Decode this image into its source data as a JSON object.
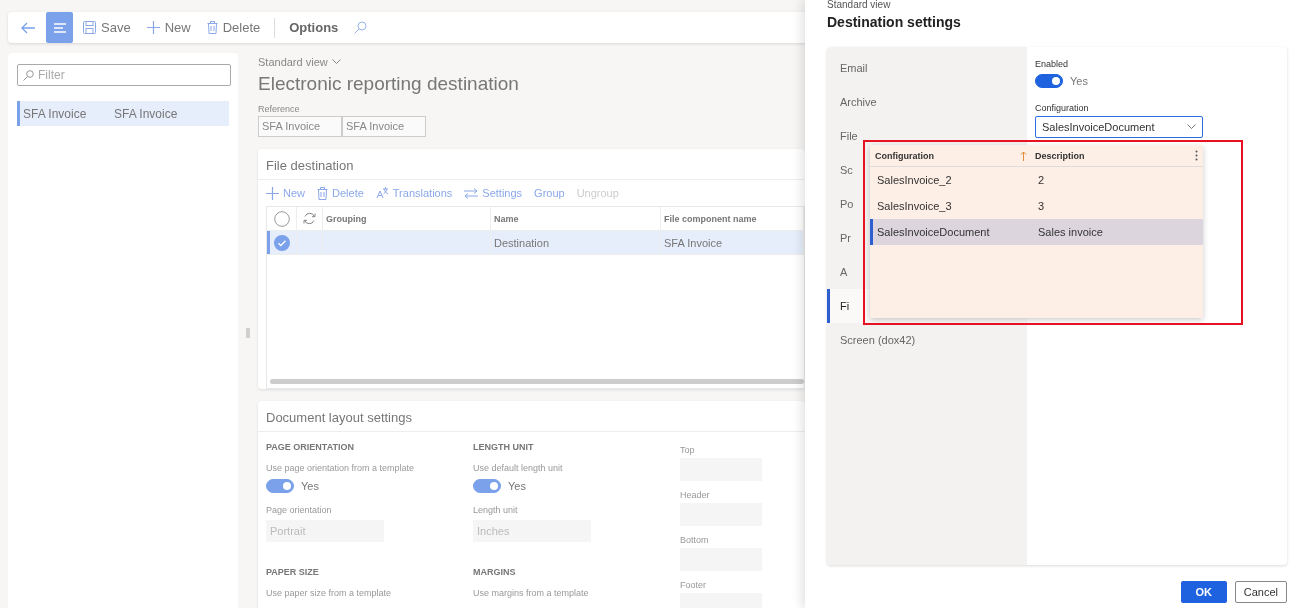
{
  "toolbar": {
    "items": [
      {
        "kind": "back"
      },
      {
        "kind": "nav",
        "selected": true
      },
      {
        "kind": "save",
        "label": "Save"
      },
      {
        "kind": "new",
        "label": "New"
      },
      {
        "kind": "delete",
        "label": "Delete"
      },
      {
        "kind": "divider"
      },
      {
        "kind": "text",
        "label": "Options"
      },
      {
        "kind": "search"
      }
    ]
  },
  "list": {
    "filter": {
      "placeholder": "Filter"
    },
    "rows": [
      {
        "cells": [
          "SFA Invoice",
          "SFA Invoice"
        ],
        "selected": true
      }
    ]
  },
  "main": {
    "view": "Standard view",
    "title": "Electronic reporting destination",
    "reference": {
      "label": "Reference",
      "values": [
        "SFA Invoice",
        "SFA Invoice"
      ]
    },
    "file_destination": {
      "title": "File destination",
      "actions": [
        {
          "kind": "new",
          "label": "New",
          "disabled": false
        },
        {
          "kind": "delete",
          "label": "Delete",
          "disabled": false
        },
        {
          "kind": "translations",
          "label": "Translations",
          "disabled": false
        },
        {
          "kind": "settings",
          "label": "Settings",
          "disabled": false
        },
        {
          "kind": "text",
          "label": "Group",
          "disabled": false
        },
        {
          "kind": "text",
          "label": "Ungroup",
          "disabled": true
        }
      ],
      "columns": [
        "Grouping",
        "Name",
        "File component name"
      ],
      "rows": [
        {
          "selected": true,
          "name": "Destination",
          "file_component_name": "SFA Invoice"
        }
      ]
    },
    "layout_settings": {
      "title": "Document layout settings",
      "columns": [
        [
          {
            "heading": "PAGE ORIENTATION",
            "toggle_label": "Use page orientation from a template",
            "on": true,
            "toggle_text": "Yes",
            "field_label": "Page orientation",
            "field_value": "Portrait"
          },
          {
            "heading": "PAPER SIZE",
            "toggle_label": "Use paper size from a template"
          }
        ],
        [
          {
            "heading": "LENGTH UNIT",
            "toggle_label": "Use default length unit",
            "on": true,
            "toggle_text": "Yes",
            "field_label": "Length unit",
            "field_value": "Inches"
          },
          {
            "heading": "MARGINS",
            "toggle_label": "Use margins from a template"
          }
        ]
      ],
      "margin_fields": [
        "Top",
        "Header",
        "Bottom",
        "Footer"
      ]
    }
  },
  "panel": {
    "view": "Standard view",
    "title": "Destination settings",
    "tabs": [
      {
        "label": "Email",
        "selected": false
      },
      {
        "label": "Archive",
        "selected": false
      },
      {
        "label": "File",
        "selected": false
      },
      {
        "label": "Sc",
        "selected": false
      },
      {
        "label": "Po",
        "selected": false
      },
      {
        "label": "Pr",
        "selected": false
      },
      {
        "label": "A",
        "selected": false
      },
      {
        "label": "Fi",
        "selected": true
      },
      {
        "label": "Screen (dox42)",
        "selected": false
      }
    ],
    "enabled": {
      "label": "Enabled",
      "on": true,
      "text": "Yes"
    },
    "configuration": {
      "label": "Configuration",
      "value": "SalesInvoiceDocument"
    },
    "lookup": {
      "columns": [
        "Configuration",
        "Description"
      ],
      "rows": [
        {
          "configuration": "SalesInvoice_2",
          "description": "2",
          "selected": false
        },
        {
          "configuration": "SalesInvoice_3",
          "description": "3",
          "selected": false
        },
        {
          "configuration": "SalesInvoiceDocument",
          "description": "Sales invoice",
          "selected": true
        }
      ]
    },
    "buttons": [
      {
        "kind": "primary",
        "label": "OK"
      },
      {
        "kind": "secondary",
        "label": "Cancel"
      }
    ]
  }
}
